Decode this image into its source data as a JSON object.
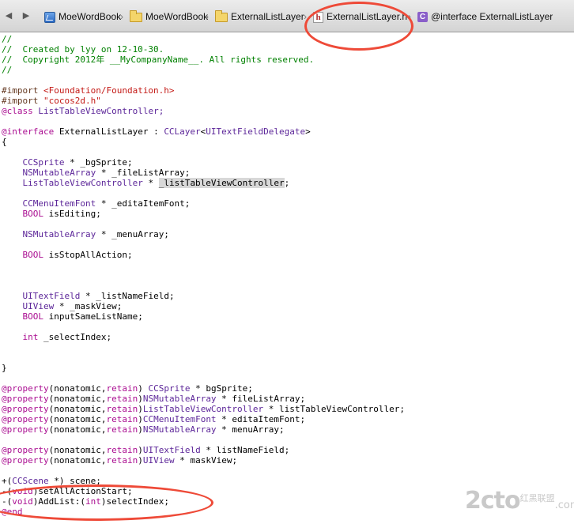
{
  "jumpbar": {
    "back_glyph": "◀",
    "forward_glyph": "▶",
    "separator": "›",
    "crumbs": [
      {
        "label": "MoeWordBook",
        "icon": "project-icon"
      },
      {
        "label": "MoeWordBook",
        "icon": "folder-icon"
      },
      {
        "label": "ExternalListLayer",
        "icon": "folder-icon"
      },
      {
        "label": "ExternalListLayer.h",
        "icon": "header-file-icon",
        "icon_glyph": "h"
      },
      {
        "label": "@interface ExternalListLayer",
        "icon": "class-icon",
        "icon_glyph": "C"
      }
    ]
  },
  "code": {
    "l01": "//",
    "l02": "//  Created by lyy on 12-10-30.",
    "l03": "//  Copyright 2012年 __MyCompanyName__. All rights reserved.",
    "l04": "//",
    "l06a": "#import ",
    "l06b": "<Foundation/Foundation.h>",
    "l07a": "#import ",
    "l07b": "\"cocos2d.h\"",
    "l08a": "@class",
    "l08b": " ListTableViewController;",
    "l10a": "@interface",
    "l10b": " ExternalListLayer : ",
    "l10c": "CCLayer",
    "l10d": "<",
    "l10e": "UITextFieldDelegate",
    "l10f": ">",
    "l11": "{",
    "l13a": "    ",
    "l13b": "CCSprite",
    "l13c": " * _bgSprite;",
    "l14b": "NSMutableArray",
    "l14c": " * _fileListArray;",
    "l15b": "ListTableViewController",
    "l15c": " * ",
    "l15d": "_listTableViewController",
    "l15e": ";",
    "l17b": "CCMenuItemFont",
    "l17c": " * _editaItemFont;",
    "l18b": "BOOL",
    "l18c": " isEditing;",
    "l20b": "NSMutableArray",
    "l20c": " * _menuArray;",
    "l22b": "BOOL",
    "l22c": " isStopAllAction;",
    "l26b": "UITextField",
    "l26c": " * _listNameField;",
    "l27b": "UIView",
    "l27c": " * _maskView;",
    "l28b": "BOOL",
    "l28c": " inputSameListName;",
    "l30b": "int",
    "l30c": " _selectIndex;",
    "l34": "}",
    "prop": "@property",
    "l36a": "(nonatomic,",
    "l36b": "retain",
    "l36c": ") ",
    "l36d": "CCSprite",
    "l36e": " * bgSprite;",
    "l37d": "NSMutableArray",
    "l37e": " * fileListArray;",
    "l38d": "ListTableViewController",
    "l38e": " * listTableViewController;",
    "l39d": "CCMenuItemFont",
    "l39e": " * editaItemFont;",
    "l40d": "NSMutableArray",
    "l40e": " * menuArray;",
    "l42d": "UITextField",
    "l42e": " * listNameField;",
    "l43d": "UIView",
    "l43e": " * maskView;",
    "l45a": "+(",
    "l45b": "CCScene",
    "l45c": " *) scene;",
    "l46a": "-(",
    "l46b": "void",
    "l46c": ")setAllActionStart;",
    "l47b": "void",
    "l47c": ")AddList:(",
    "l47d": "int",
    "l47e": ")selectIndex;",
    "l48": "@end"
  },
  "colors": {
    "comment": "#008000",
    "preprocessor": "#643820",
    "string": "#c41a16",
    "keyword": "#aa0d91",
    "type": "#5c2699",
    "annotation": "#ee4a38"
  },
  "watermark": {
    "big": "2cto",
    "dotcom": ".com",
    "small": "红黑联盟"
  }
}
